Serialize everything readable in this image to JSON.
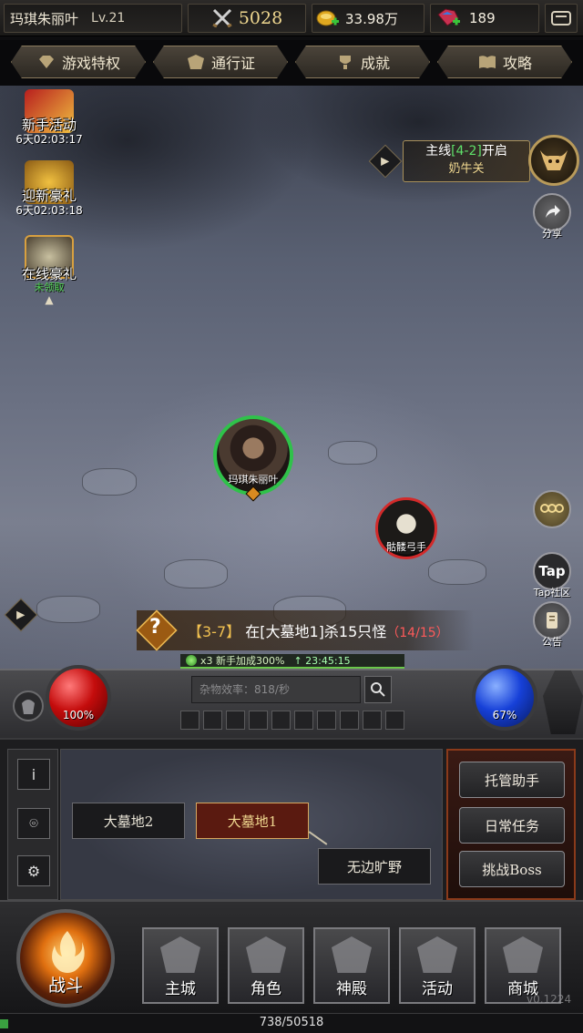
{
  "player": {
    "name": "玛琪朱丽叶",
    "level": "Lv.21"
  },
  "currency": {
    "power": "5028",
    "gold": "33.98万",
    "gems": "189"
  },
  "tabs": [
    "游戏特权",
    "通行证",
    "成就",
    "攻略"
  ],
  "events": [
    {
      "name": "新手活动",
      "time": "6天02:03:17",
      "status": ""
    },
    {
      "name": "迎新豪礼",
      "time": "6天02:03:18",
      "status": ""
    },
    {
      "name": "在线豪礼",
      "time": "",
      "status": "未领取"
    }
  ],
  "main_quest": {
    "prefix": "主线",
    "stage": "[4-2]",
    "suffix": "开启",
    "location": "奶牛关"
  },
  "side_buttons": {
    "share": "分享",
    "tap": "Tap",
    "tap_community": "Tap社区",
    "notice": "公告"
  },
  "hero": {
    "name": "玛琪朱丽叶"
  },
  "enemy": {
    "name": "骷髅弓手"
  },
  "task": {
    "stage": "【3-7】",
    "text": "在[大墓地1]杀15只怪",
    "progress": "（14/15）"
  },
  "buff": {
    "text": "x3 新手加成300%",
    "time": "23:45:15"
  },
  "hud": {
    "hp": "100%",
    "mp": "67%",
    "search_placeholder": "杂物效率：818/秒"
  },
  "map": {
    "nodes": [
      "大墓地2",
      "大墓地1",
      "无边旷野"
    ],
    "active": "大墓地1"
  },
  "right_menu": [
    "托管助手",
    "日常任务",
    "挑战Boss"
  ],
  "nav": {
    "combat": "战斗",
    "items": [
      "主城",
      "角色",
      "神殿",
      "活动",
      "商城"
    ]
  },
  "version": "v0.1224",
  "exp": {
    "text": "738/50518",
    "current": 738,
    "max": 50518
  },
  "colors": {
    "hp": "#c40c0c",
    "mp": "#1640d8",
    "quest_highlight": "#5fe06a",
    "task_progress": "#ff5a5a",
    "exp": "#3aa040"
  }
}
